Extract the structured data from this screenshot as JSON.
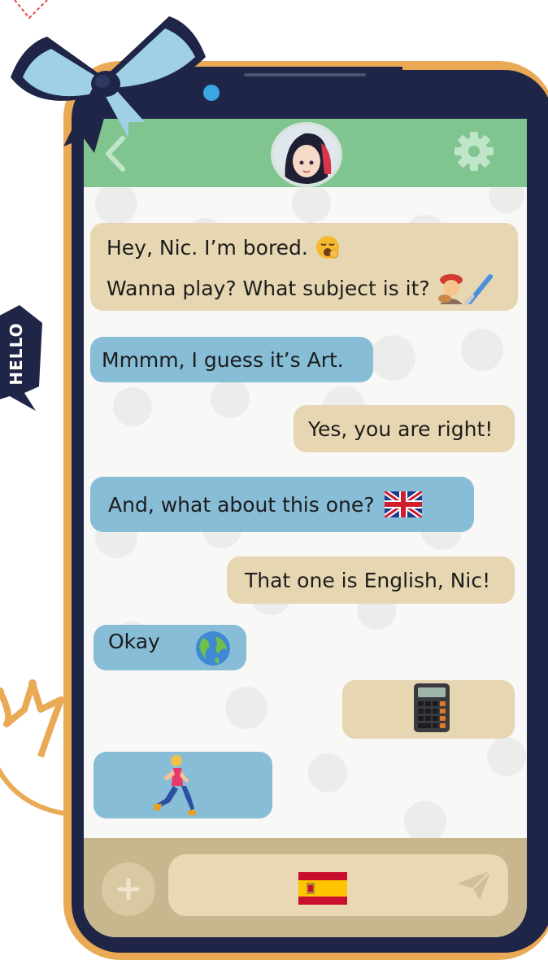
{
  "chat": {
    "messages": [
      {
        "side": "in",
        "lines": [
          "Hey, Nic. I’m bored.",
          "Wanna play? What subject is it?"
        ],
        "emojis": [
          "yawning-face-emoji",
          "artist-emoji"
        ]
      },
      {
        "side": "in",
        "text": "Mmmm, I guess it’s Art."
      },
      {
        "side": "out",
        "text": "Yes, you are right!"
      },
      {
        "side": "in",
        "text": "And, what about this one?",
        "emoji": "uk-flag-emoji"
      },
      {
        "side": "out",
        "text": "That one is English, Nic!"
      },
      {
        "side": "in",
        "text": "Okay",
        "emoji": "globe-emoji"
      },
      {
        "side": "out",
        "emoji": "calculator-emoji"
      },
      {
        "side": "in",
        "emoji": "runner-emoji"
      }
    ]
  },
  "composer": {
    "draft_emoji": "spain-flag-emoji"
  },
  "decorations": {
    "tag_text": "HELLO"
  },
  "colors": {
    "header": "#80c590",
    "incoming_bubble": "#87bdd6",
    "outgoing_bubble": "#e6d6b2",
    "phone_frame": "#e9a955",
    "bezel": "#1f2546"
  }
}
